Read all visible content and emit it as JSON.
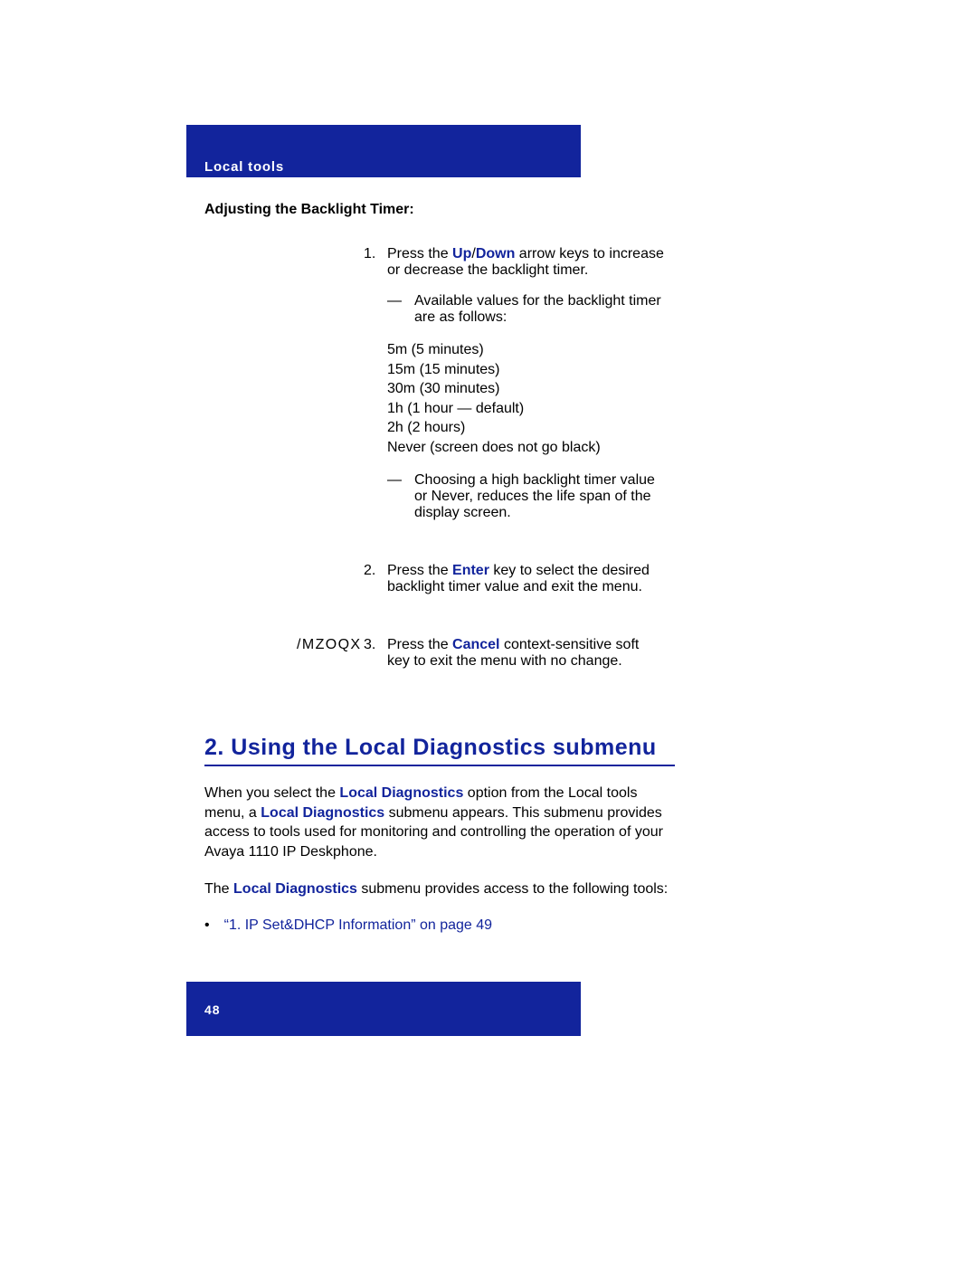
{
  "header": {
    "section": "Local tools"
  },
  "subhead": "Adjusting the Backlight Timer:",
  "steps": {
    "left3": "/MZOQX",
    "s1": {
      "num": "1.",
      "pre": "Press the ",
      "up": "Up",
      "slash": "/",
      "down": "Down",
      "post": " arrow keys to increase or decrease the backlight timer."
    },
    "s1b": {
      "dash": "—",
      "text": "Available values for the backlight timer are as follows:"
    },
    "values": [
      "5m (5 minutes)",
      "15m (15 minutes)",
      "30m (30 minutes)",
      "1h (1 hour — default)",
      "2h (2 hours)",
      "Never (screen does not go black)"
    ],
    "s1c": {
      "dash": "—",
      "text": "Choosing a high backlight timer value or Never, reduces the life span of the display screen."
    },
    "s2": {
      "num": "2.",
      "pre": "Press the ",
      "enter": "Enter",
      "post": " key to select the desired backlight timer value and exit the menu."
    },
    "s3": {
      "num": "3.",
      "pre": "Press the ",
      "cancel": "Cancel",
      "post": " context-sensitive soft key to exit the menu with no change."
    }
  },
  "h2": "2. Using the Local Diagnostics submenu",
  "p1": {
    "a": "When you select the ",
    "b": "Local Diagnostics",
    "c": " option from the Local tools menu, a ",
    "d": "Local Diagnostics",
    "e": " submenu appears. This submenu provides access to tools used for monitoring and controlling the operation of your Avaya 1110 IP  Deskphone."
  },
  "p2": {
    "a": "The ",
    "b": "Local Diagnostics",
    "c": " submenu provides access to the following tools:"
  },
  "link1": "“1. IP Set&DHCP Information” on page 49",
  "bullet_dot": "•",
  "page_number": "48"
}
